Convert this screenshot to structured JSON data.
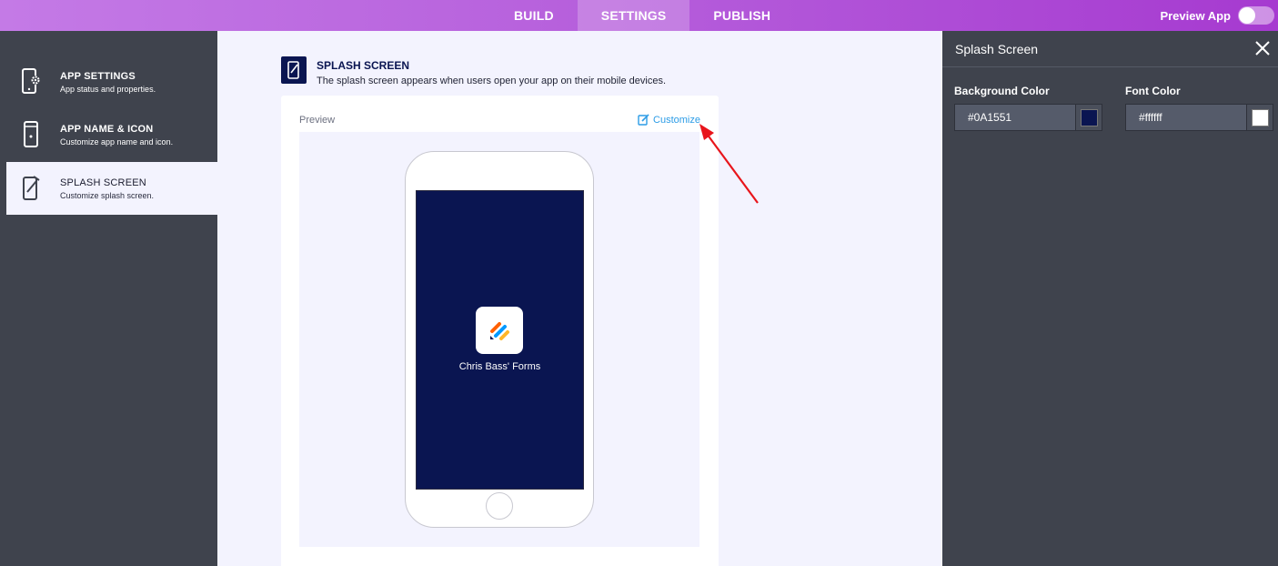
{
  "topbar": {
    "tabs": [
      {
        "label": "BUILD"
      },
      {
        "label": "SETTINGS"
      },
      {
        "label": "PUBLISH"
      }
    ],
    "preview_label": "Preview App"
  },
  "sidebar": {
    "items": [
      {
        "title": "APP SETTINGS",
        "subtitle": "App status and properties.",
        "icon": "phone-gear-icon"
      },
      {
        "title": "APP NAME & ICON",
        "subtitle": "Customize app name and icon.",
        "icon": "phone-icon"
      },
      {
        "title": "SPLASH SCREEN",
        "subtitle": "Customize splash screen.",
        "icon": "phone-edit-icon",
        "active": true
      }
    ]
  },
  "main": {
    "section_title": "SPLASH SCREEN",
    "section_desc": "The splash screen appears when users open your app on their mobile devices.",
    "preview_label": "Preview",
    "customize_label": "Customize",
    "app_name": "Chris Bass' Forms"
  },
  "panel": {
    "title": "Splash Screen",
    "bg_label": "Background Color",
    "bg_value": "#0A1551",
    "font_label": "Font Color",
    "font_value": "#ffffff"
  },
  "colors": {
    "accent_purple": "#b55ddb",
    "splash_bg": "#0A1551",
    "splash_font": "#ffffff",
    "link_blue": "#2c9ce6",
    "annotation_arrow": "#e8151b"
  }
}
